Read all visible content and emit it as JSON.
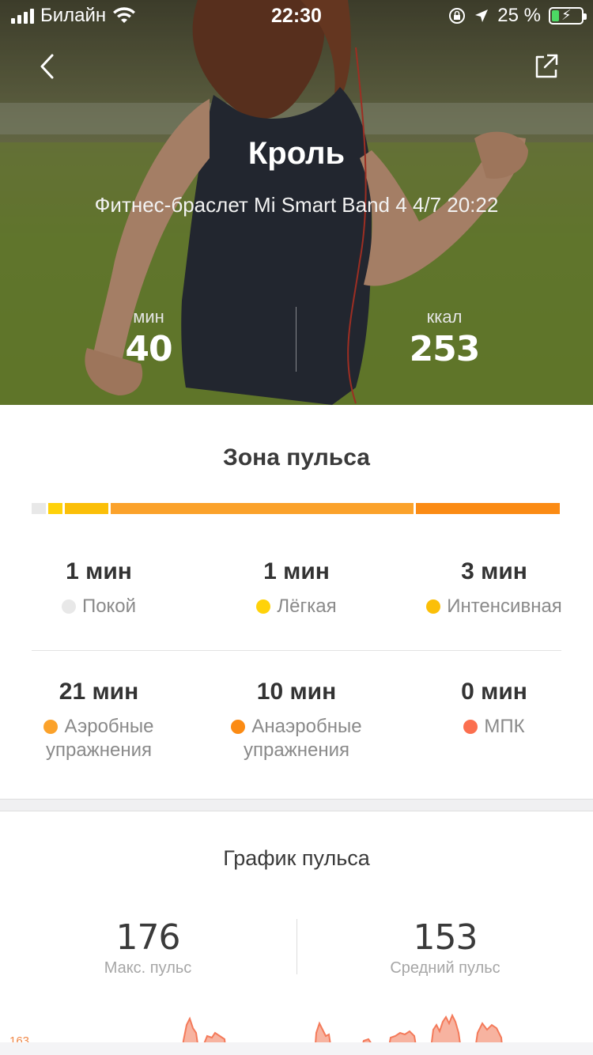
{
  "status_bar": {
    "carrier": "Билайн",
    "time": "22:30",
    "battery": "25 %",
    "battery_level": 0.25
  },
  "header": {
    "back_icon": "chevron-left-icon",
    "share_icon": "share-icon",
    "title": "Кроль",
    "subtitle": "Фитнес-браслет Mi Smart Band 4 4/7 20:22"
  },
  "summary": {
    "duration": {
      "unit": "мин",
      "value": "40"
    },
    "calories": {
      "unit": "ккал",
      "value": "253"
    }
  },
  "heart_zone": {
    "title": "Зона пульса",
    "zones": [
      {
        "amount": "1 мин",
        "label": "Покой",
        "color": "#e8e8e8",
        "minutes": 1
      },
      {
        "amount": "1 мин",
        "label": "Лёгкая",
        "color": "#ffd20a",
        "minutes": 1
      },
      {
        "amount": "3 мин",
        "label": "Интенсивная",
        "color": "#fbbf08",
        "minutes": 3
      },
      {
        "amount": "21 мин",
        "label": "Аэробные упражнения",
        "color": "#fba22b",
        "minutes": 21
      },
      {
        "amount": "10 мин",
        "label": "Анаэробные упражнения",
        "color": "#fb8b14",
        "minutes": 10
      },
      {
        "amount": "0 мин",
        "label": "МПК",
        "color": "#fb6f4f",
        "minutes": 0
      }
    ]
  },
  "heart_graph": {
    "title": "График пульса",
    "max": {
      "value": "176",
      "caption": "Макс. пульс"
    },
    "avg": {
      "value": "153",
      "caption": "Средний пульс"
    },
    "axis_label": "163",
    "line_color": "#f47a5a"
  }
}
